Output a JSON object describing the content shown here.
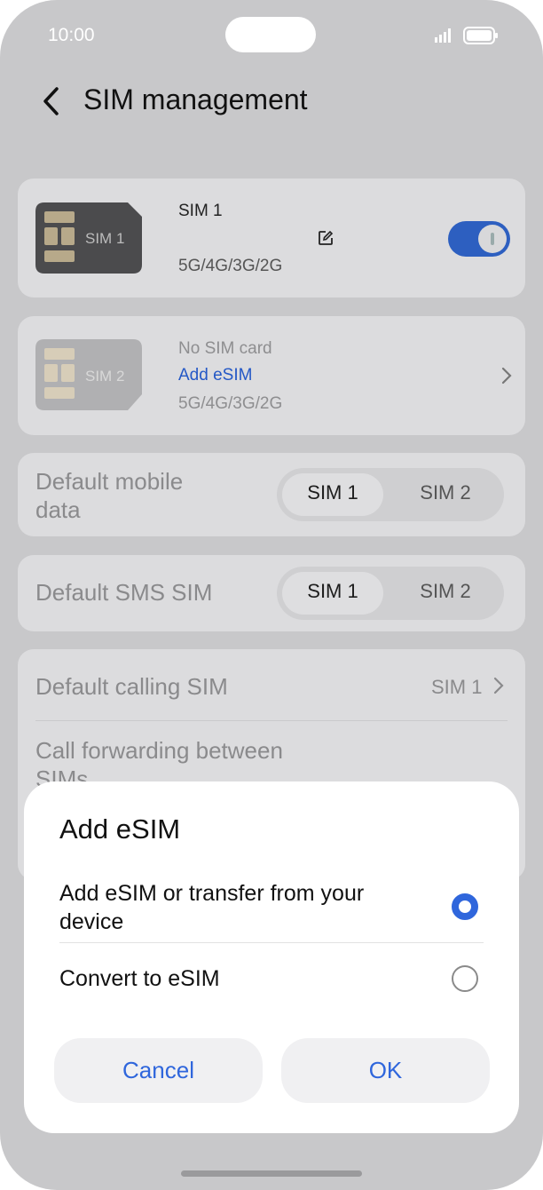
{
  "status_bar": {
    "time": "10:00"
  },
  "header": {
    "title": "SIM management"
  },
  "sim1": {
    "chip_label": "SIM 1",
    "name": "SIM 1",
    "network": "5G/4G/3G/2G",
    "enabled": true
  },
  "sim2": {
    "chip_label": "SIM 2",
    "status": "No SIM card",
    "add_link": "Add eSIM",
    "network": "5G/4G/3G/2G"
  },
  "default_mobile_data": {
    "label_line1": "Default mobile",
    "label_line2": "data",
    "options": [
      "SIM 1",
      "SIM 2"
    ],
    "selected": "SIM 1"
  },
  "default_sms": {
    "label": "Default SMS SIM",
    "options": [
      "SIM 1",
      "SIM 2"
    ],
    "selected": "SIM 1"
  },
  "default_calling": {
    "label": "Default calling SIM",
    "value": "SIM 1"
  },
  "call_forwarding": {
    "label_line1": "Call forwarding between",
    "label_line2": "SIMs"
  },
  "dialog": {
    "title": "Add eSIM",
    "options": [
      {
        "line1": "Add eSIM or transfer from your",
        "line2": "device",
        "selected": true
      },
      {
        "line1": "Convert to eSIM",
        "selected": false
      }
    ],
    "cancel_label": "Cancel",
    "ok_label": "OK"
  },
  "colors": {
    "accent": "#2f66dc",
    "scrim_background": "#c8c8ca",
    "link": "#2458c6"
  }
}
